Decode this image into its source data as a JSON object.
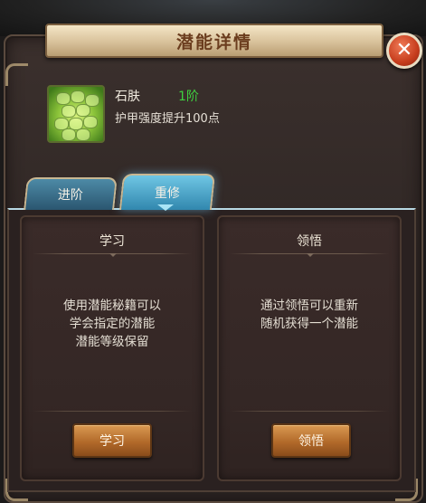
{
  "dialog": {
    "title": "潜能详情"
  },
  "skill": {
    "name": "石肤",
    "level": "1阶",
    "description": "护甲强度提升100点"
  },
  "tabs": [
    {
      "label": "进阶",
      "active": false
    },
    {
      "label": "重修",
      "active": true
    }
  ],
  "cards": {
    "learn": {
      "title": "学习",
      "text": "使用潜能秘籍可以\n学会指定的潜能\n潜能等级保留",
      "button": "学习"
    },
    "comprehend": {
      "title": "领悟",
      "text": "通过领悟可以重新\n随机获得一个潜能",
      "button": "领悟"
    }
  },
  "colors": {
    "level_green": "#3fcf3f",
    "title_brown": "#6b3d1e",
    "tab_active": "#3187ae",
    "button_orange": "#b26a2a",
    "close_red": "#c63d1d"
  },
  "icons": {
    "close": "close-icon",
    "skill": "stone-skin-icon"
  }
}
